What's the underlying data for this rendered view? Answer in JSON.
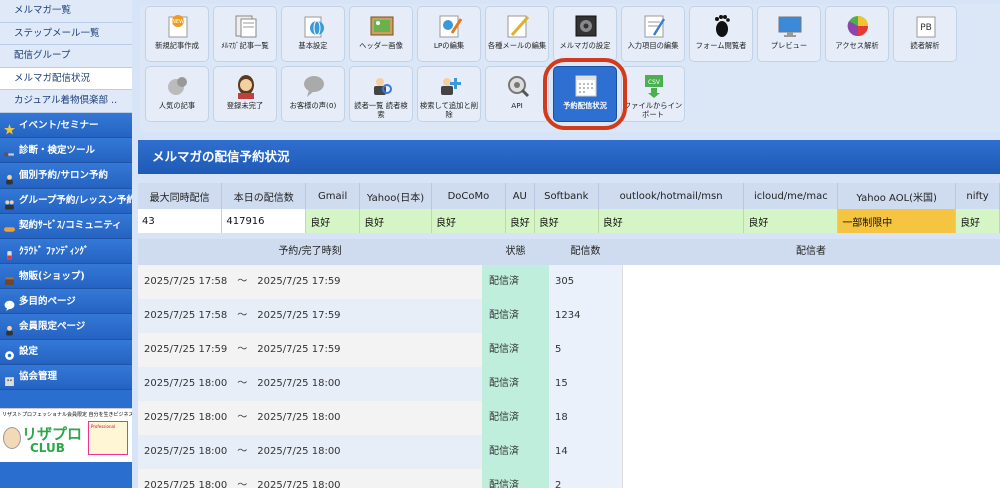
{
  "sidebar": {
    "sub_items": [
      {
        "label": "メルマガ一覧",
        "active": false
      },
      {
        "label": "ステップメール一覧",
        "active": false
      },
      {
        "label": "配信グループ",
        "active": false
      },
      {
        "label": "メルマガ配信状況",
        "active": true
      },
      {
        "label": "カジュアル着物倶楽部 ..",
        "active": false
      }
    ],
    "main_items": [
      {
        "label": "イベント/セミナー",
        "icon": "star-icon",
        "color": "#f4c430"
      },
      {
        "label": "診断・検定ツール",
        "icon": "tool-icon",
        "color": "#555555"
      },
      {
        "label": "個別予約/サロン予約",
        "icon": "person-icon",
        "color": "#333333"
      },
      {
        "label": "グループ予約/レッスン予約",
        "icon": "group-icon",
        "color": "#333333"
      },
      {
        "label": "契約ｻｰﾋﾞｽ/コミュニティ",
        "icon": "handshake-icon",
        "color": "#f0a030"
      },
      {
        "label": "ｸﾗｳﾄﾞ ﾌｧﾝﾃﾞｨﾝｸﾞ",
        "icon": "funding-icon",
        "color": "#d04040"
      },
      {
        "label": "物販(ショップ)",
        "icon": "box-icon",
        "color": "#6a4a2a"
      },
      {
        "label": "多目的ページ",
        "icon": "bubble-icon",
        "color": "#ffffff"
      },
      {
        "label": "会員限定ページ",
        "icon": "member-icon",
        "color": "#333333"
      },
      {
        "label": "設定",
        "icon": "gear-icon",
        "color": "#ffffff"
      },
      {
        "label": "協会管理",
        "icon": "building-icon",
        "color": "#dddddd"
      }
    ],
    "banner": {
      "top_text": "リザストプロフェッショナル会員限定 自分を生きビジネスを軌道に乗せる起業コミュニティ",
      "title": "リザプロ",
      "subtitle": "CLUB",
      "side_text": "Professional"
    }
  },
  "toolbar": {
    "buttons": [
      {
        "label": "新規記事作成",
        "icon": "new-article-icon"
      },
      {
        "label": "ﾒﾙﾏｶﾞ記事一覧",
        "icon": "article-list-icon"
      },
      {
        "label": "基本設定",
        "icon": "globe-settings-icon"
      },
      {
        "label": "ヘッダー画像",
        "icon": "header-image-icon"
      },
      {
        "label": "LPの編集",
        "icon": "lp-edit-icon"
      },
      {
        "label": "各種メールの編集",
        "icon": "mail-edit-icon"
      },
      {
        "label": "メルマガの設定",
        "icon": "mailmag-settings-icon"
      },
      {
        "label": "入力項目の編集",
        "icon": "form-fields-icon"
      },
      {
        "label": "フォーム閲覧者",
        "icon": "footprint-icon"
      },
      {
        "label": "プレビュー",
        "icon": "monitor-icon"
      },
      {
        "label": "アクセス解析",
        "icon": "pie-chart-icon"
      },
      {
        "label": "読者解析",
        "icon": "reader-analysis-icon"
      },
      {
        "label": "人気の記事",
        "icon": "popular-article-icon"
      },
      {
        "label": "登録未完了",
        "icon": "incomplete-user-icon"
      },
      {
        "label": "お客様の声(0)",
        "icon": "speech-bubble-icon"
      },
      {
        "label": "読者一覧 読者検索",
        "icon": "reader-search-icon"
      },
      {
        "label": "検索して追加と削除",
        "icon": "search-add-icon"
      },
      {
        "label": "API",
        "icon": "api-gear-icon"
      },
      {
        "label": "予約配信状況",
        "icon": "calendar-icon"
      },
      {
        "label": "ファイルからインポート",
        "icon": "csv-import-icon"
      }
    ]
  },
  "section": {
    "title": "メルマガの配信予約状況"
  },
  "stats": {
    "headers": [
      "最大同時配信",
      "本日の配信数",
      "Gmail",
      "Yahoo(日本)",
      "DoCoMo",
      "AU",
      "Softbank",
      "outlook/hotmail/msn",
      "icloud/me/mac",
      "Yahoo AOL(米国)",
      "nifty"
    ],
    "values": [
      "43",
      "417916",
      "良好",
      "良好",
      "良好",
      "良好",
      "良好",
      "良好",
      "良好",
      "一部制限中",
      "良好"
    ]
  },
  "schedule": {
    "headers": {
      "time": "予約/完了時刻",
      "status": "状態",
      "count": "配信数",
      "sender": "配信者"
    },
    "rows": [
      {
        "time": "2025/7/25 17:58　～　2025/7/25 17:59",
        "status": "配信済",
        "count": "305"
      },
      {
        "time": "2025/7/25 17:58　～　2025/7/25 17:59",
        "status": "配信済",
        "count": "1234"
      },
      {
        "time": "2025/7/25 17:59　～　2025/7/25 17:59",
        "status": "配信済",
        "count": "5"
      },
      {
        "time": "2025/7/25 18:00　～　2025/7/25 18:00",
        "status": "配信済",
        "count": "15"
      },
      {
        "time": "2025/7/25 18:00　～　2025/7/25 18:00",
        "status": "配信済",
        "count": "18"
      },
      {
        "time": "2025/7/25 18:00　～　2025/7/25 18:00",
        "status": "配信済",
        "count": "14"
      },
      {
        "time": "2025/7/25 18:00　～　2025/7/25 18:00",
        "status": "配信済",
        "count": "2"
      }
    ]
  }
}
